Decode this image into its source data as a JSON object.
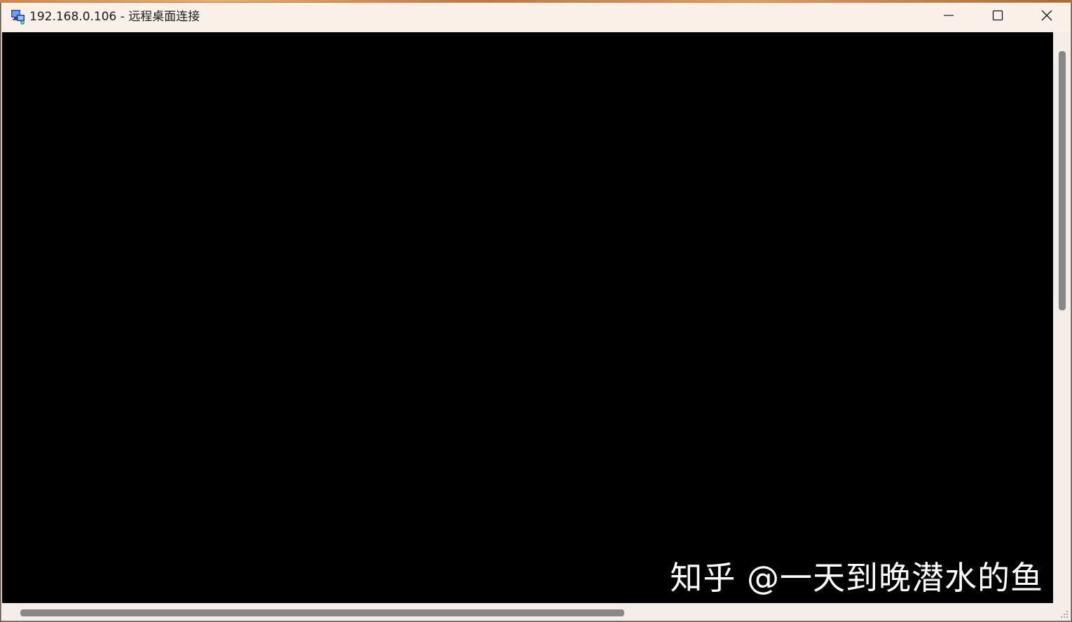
{
  "window": {
    "title": "192.168.0.106 - 远程桌面连接",
    "app_icon": "remote-desktop-icon",
    "controls": {
      "minimize_icon": "minimize-icon",
      "maximize_icon": "maximize-icon",
      "close_icon": "close-icon"
    }
  },
  "remote_session": {
    "watermark": "知乎 @一天到晚潜水的鱼"
  },
  "scrollbars": {
    "vertical": "scrollbar-vertical",
    "horizontal": "scrollbar-horizontal"
  },
  "colors": {
    "titlebar_bg": "#f8f0e9",
    "viewport_bg": "#000000",
    "scroll_thumb": "#878787"
  }
}
